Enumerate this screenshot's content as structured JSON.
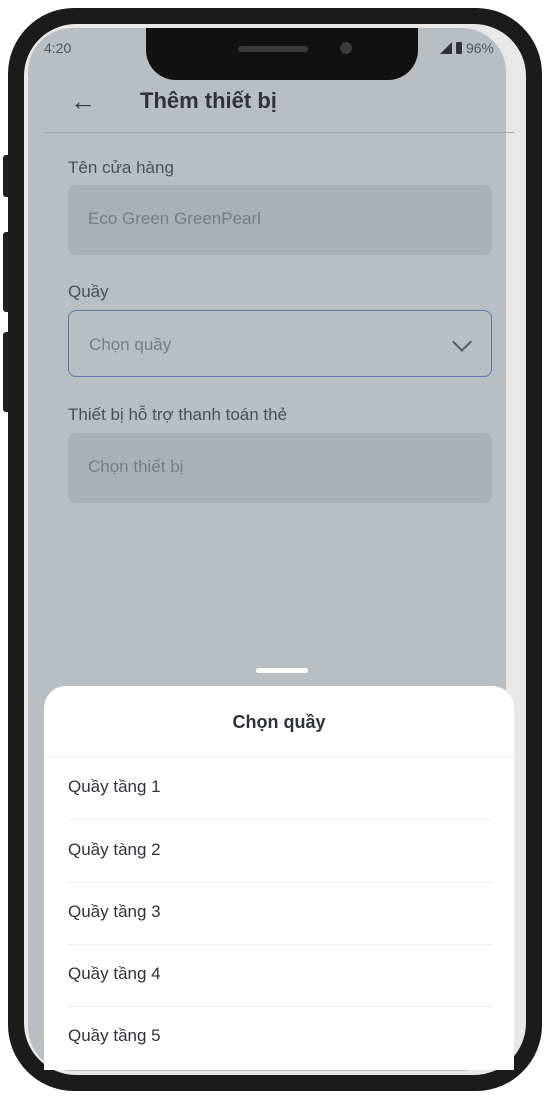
{
  "status": {
    "time": "4:20",
    "battery": "96%"
  },
  "appbar": {
    "back_icon": "arrow-left-icon",
    "title": "Thêm thiết bị"
  },
  "form": {
    "store_label": "Tên cửa hàng",
    "store_value": "Eco Green GreenPearl",
    "counter_label": "Quầy",
    "counter_placeholder": "Chọn quầy",
    "device_label": "Thiết bị hỗ trợ thanh toán thẻ",
    "device_placeholder": "Chọn thiết bị"
  },
  "sheet": {
    "title": "Chọn quầy",
    "items": [
      "Quầy tầng 1",
      "Quầy tàng 2",
      "Quầy tầng 3",
      "Quầy tầng 4",
      "Quầy tầng 5"
    ]
  }
}
